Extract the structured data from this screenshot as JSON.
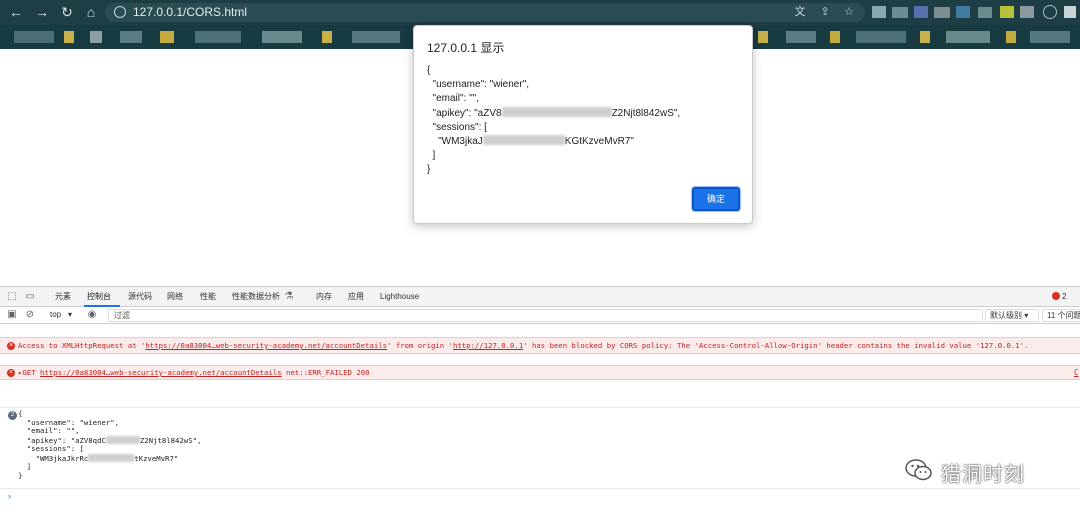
{
  "browser": {
    "url": "127.0.0.1/CORS.html",
    "icons": {
      "back": "back-arrow-icon",
      "forward": "forward-arrow-icon",
      "reload": "reload-icon",
      "home": "home-icon",
      "info": "info-icon",
      "translate": "translate-icon",
      "share": "share-icon",
      "bookmark": "star-icon"
    }
  },
  "dialog": {
    "title": "127.0.0.1 显示",
    "lines": [
      "{",
      "  \"username\": \"wiener\",",
      "  \"email\": \"\",",
      "  \"apikey\": \"aZV8",
      "Z2Njt8l842wS\",",
      "  \"sessions\": [",
      "    \"WM3jkaJ",
      "KGtKzveMvR7\"",
      "  ]",
      "}"
    ],
    "ok_label": "确定"
  },
  "devtools": {
    "tabs": [
      "元素",
      "控制台",
      "源代码",
      "网络",
      "性能",
      "性能数据分析",
      "内存",
      "应用",
      "Lighthouse"
    ],
    "active_tab": "控制台",
    "error_count": "2",
    "context": "top",
    "filter_placeholder": "过滤",
    "levels": "默认级别",
    "issues": "11 个问题",
    "messages": {
      "cors_error_prefix": "Access to XMLHttpRequest at '",
      "cors_error_url": "https://0a83004…web-security-academy.net/accountDetails",
      "cors_error_mid": "' from origin '",
      "cors_error_origin": "http://127.0.0.1",
      "cors_error_suffix": "' has been blocked by CORS policy: The 'Access-Control-Allow-Origin' header contains the invalid value '127.0.0.1'.",
      "get_prefix": "GET",
      "get_url": "https://0a83004…web-security-academy.net/accountDetails",
      "get_suffix": "net::ERR_FAILED 200",
      "get_source": "C"
    },
    "log": {
      "badge": "2",
      "lines": [
        "{",
        "  \"username\": \"wiener\",",
        "  \"email\": \"\",",
        "  \"apikey\": \"aZV8qdC",
        "Z2Njt8l842wS\",",
        "  \"sessions\": [",
        "    \"WM3jkaJkrRc",
        "tKzveMvR7\"",
        "  ]",
        "}"
      ]
    },
    "prompt": "›"
  },
  "watermark": {
    "text": "猎洞时刻",
    "icon": "wechat-icon"
  },
  "colors": {
    "chrome_bg": "#1f3d44",
    "accent": "#1a73e8",
    "error": "#d93025",
    "error_bg": "#fcebeb"
  }
}
